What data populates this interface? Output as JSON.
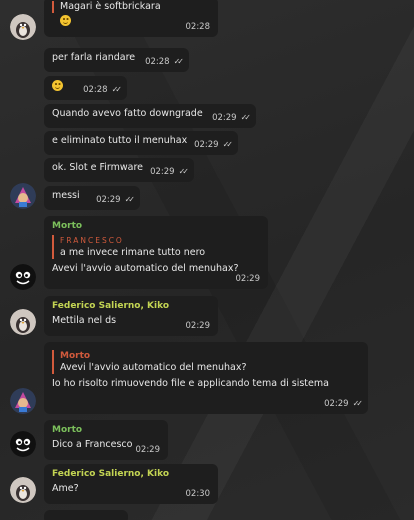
{
  "messages": [
    {
      "quote_text": "Magari è softbrickara",
      "time": "02:28"
    },
    {
      "text": "per farla riandare",
      "time": "02:28"
    },
    {
      "emoji": "smiling-face",
      "time": "02:28"
    },
    {
      "text": "Quando avevo fatto downgrade",
      "time": "02:29"
    },
    {
      "text": "e eliminato tutto il menuhax",
      "time": "02:29"
    },
    {
      "text": "ok. Slot e Firmware",
      "time": "02:29"
    },
    {
      "text": "messi",
      "time": "02:29"
    },
    {
      "sender": "Morto",
      "quote_name": "FRANCESCO",
      "quote_text": "a me invece rimane tutto nero",
      "text": "Avevi l'avvio automatico del menuhax?",
      "time": "02:29"
    },
    {
      "sender": "Federico Salierno, Kiko",
      "text": "Mettila nel ds",
      "time": "02:29"
    },
    {
      "quote_name": "Morto",
      "quote_text": "Avevi l'avvio automatico del menuhax?",
      "text": "Io ho risolto rimuovendo file e applicando tema di sistema",
      "time": "02:29"
    },
    {
      "sender": "Morto",
      "text": "Dico a Francesco",
      "time": "02:29"
    },
    {
      "sender": "Federico Salierno, Kiko",
      "text": "Ame?",
      "time": "02:30"
    }
  ],
  "colors": {
    "background": "#2a2a2a",
    "bubble": "#1e1e1e",
    "sender_green": "#7cc05c",
    "sender_yellow": "#c3d453",
    "quote_accent": "#d15a3c"
  },
  "icons": [
    "penguin-avatar",
    "character-avatar",
    "cartoon-face-avatar",
    "read-double-check-icon",
    "smile-emoji-icon"
  ]
}
